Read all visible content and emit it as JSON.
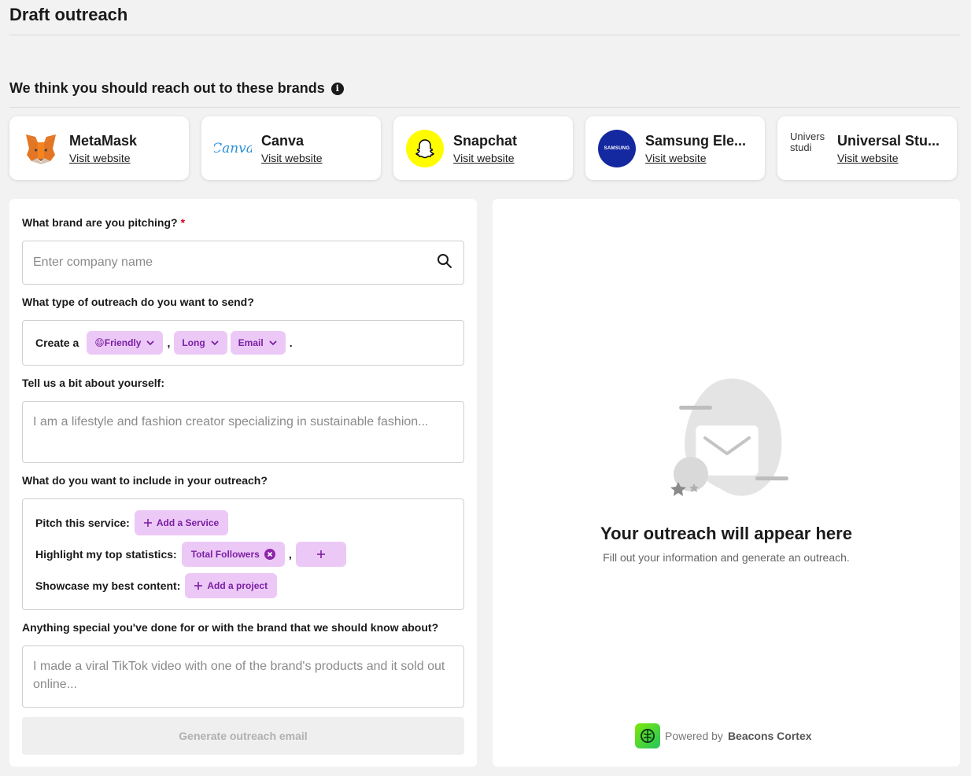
{
  "header": {
    "title": "Draft outreach"
  },
  "brands_section": {
    "heading": "We think you should reach out to these brands",
    "info_glyph": "i",
    "brands": [
      {
        "name": "MetaMask",
        "link": "Visit website",
        "logo": "metamask-fox-icon"
      },
      {
        "name": "Canva",
        "link": "Visit website",
        "logo_text": "Canva"
      },
      {
        "name": "Snapchat",
        "link": "Visit website",
        "logo": "snapchat-ghost-icon"
      },
      {
        "name": "Samsung Ele...",
        "link": "Visit website",
        "logo_text": "SAMSUNG"
      },
      {
        "name": "Universal Stu...",
        "link": "Visit website",
        "logo_text": "Univers studi"
      }
    ]
  },
  "form": {
    "brand_label": "What brand are you pitching?",
    "required_mark": "*",
    "brand_placeholder": "Enter company name",
    "outreach_label": "What type of outreach do you want to send?",
    "create_label": "Create a",
    "tone": "😄Friendly",
    "length": "Long",
    "channel": "Email",
    "comma": ",",
    "period": ".",
    "about_label": "Tell us a bit about yourself:",
    "about_placeholder": "I am a lifestyle and fashion creator specializing in sustainable fashion...",
    "include_label": "What do you want to include in your outreach?",
    "pitch_label": "Pitch this service:",
    "add_service": "Add a Service",
    "stats_label": "Highlight my top statistics:",
    "stat_chip": "Total Followers",
    "content_label": "Showcase my best content:",
    "add_project": "Add a project",
    "special_label": "Anything special you've done for or with the brand that we should know about?",
    "special_placeholder": "I made a viral TikTok video with one of the brand's products and it sold out online...",
    "generate_button": "Generate outreach email"
  },
  "result": {
    "title": "Your outreach will appear here",
    "subtitle": "Fill out your information and generate an outreach.",
    "powered_prefix": "Powered by",
    "powered_brand": "Beacons Cortex"
  },
  "colors": {
    "accent_pill": "#ecc8f7",
    "accent_text": "#7b1fa2",
    "required": "#d0021b"
  }
}
